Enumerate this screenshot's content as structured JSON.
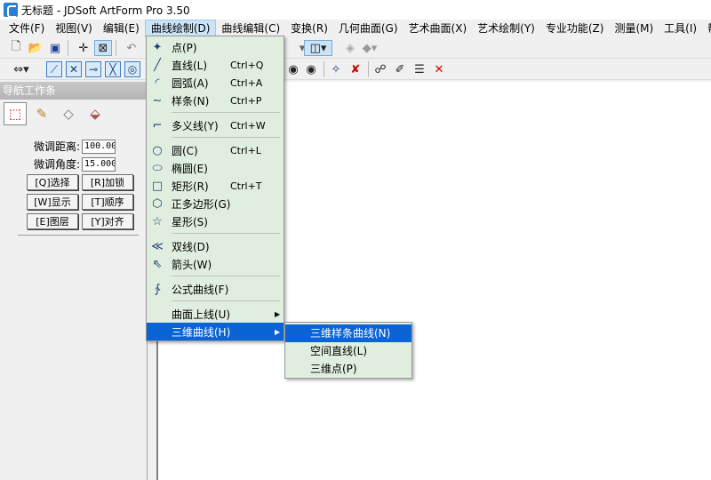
{
  "window": {
    "title": "无标题 - JDSoft ArtForm Pro 3.50"
  },
  "menubar": [
    {
      "label": "文件(F)"
    },
    {
      "label": "视图(V)"
    },
    {
      "label": "编辑(E)"
    },
    {
      "label": "曲线绘制(D)"
    },
    {
      "label": "曲线编辑(C)"
    },
    {
      "label": "变换(R)"
    },
    {
      "label": "几何曲面(G)"
    },
    {
      "label": "艺术曲面(X)"
    },
    {
      "label": "艺术绘制(Y)"
    },
    {
      "label": "专业功能(Z)"
    },
    {
      "label": "测量(M)"
    },
    {
      "label": "工具(I)"
    },
    {
      "label": "帮助("
    }
  ],
  "nav": {
    "header": "导航工作条",
    "dist_label": "微调距离:",
    "dist_value": "100.00",
    "angle_label": "微调角度:",
    "angle_value": "15.000",
    "buttons": {
      "select": "[Q]选择",
      "lock": "[R]加锁",
      "show": "[W]显示",
      "order": "[T]顺序",
      "layer": "[E]图层",
      "align": "[Y]对齐"
    }
  },
  "dropdown": [
    {
      "label": "点(P)",
      "shortcut": "",
      "icon": "✦"
    },
    {
      "label": "直线(L)",
      "shortcut": "Ctrl+Q",
      "icon": "╱"
    },
    {
      "label": "圆弧(A)",
      "shortcut": "Ctrl+A",
      "icon": "◜"
    },
    {
      "label": "样条(N)",
      "shortcut": "Ctrl+P",
      "icon": "∼"
    },
    {
      "label": "多义线(Y)",
      "shortcut": "Ctrl+W",
      "icon": "⌐"
    },
    {
      "label": "圆(C)",
      "shortcut": "Ctrl+L",
      "icon": "○"
    },
    {
      "label": "椭圆(E)",
      "shortcut": "",
      "icon": "⬭"
    },
    {
      "label": "矩形(R)",
      "shortcut": "Ctrl+T",
      "icon": "□"
    },
    {
      "label": "正多边形(G)",
      "shortcut": "",
      "icon": "⬡"
    },
    {
      "label": "星形(S)",
      "shortcut": "",
      "icon": "☆"
    },
    {
      "label": "双线(D)",
      "shortcut": "",
      "icon": "≪"
    },
    {
      "label": "箭头(W)",
      "shortcut": "",
      "icon": "⇖"
    },
    {
      "label": "公式曲线(F)",
      "shortcut": "",
      "icon": "∱"
    },
    {
      "label": "曲面上线(U)",
      "shortcut": "",
      "icon": ""
    },
    {
      "label": "三维曲线(H)",
      "shortcut": "",
      "icon": ""
    }
  ],
  "submenu": [
    {
      "label": "三维样条曲线(N)"
    },
    {
      "label": "空间直线(L)"
    },
    {
      "label": "三维点(P)"
    }
  ]
}
